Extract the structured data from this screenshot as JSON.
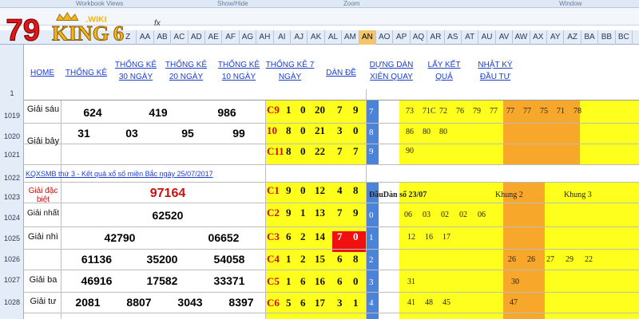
{
  "ribbon": {
    "labels": [
      "Workbook Views",
      "Show/Hide",
      "Zoom",
      "Window"
    ]
  },
  "formula_bar": {
    "name_box": "",
    "fx": "fx"
  },
  "logo": {
    "number": "79",
    "brand": "KING",
    "suffix": ".WIKI",
    "digit": "6"
  },
  "columns": [
    "Z",
    "AA",
    "AB",
    "AC",
    "AD",
    "AE",
    "AF",
    "AG",
    "AH",
    "AI",
    "AJ",
    "AK",
    "AL",
    "AM",
    "AN",
    "AO",
    "AP",
    "AQ",
    "AR",
    "AS",
    "AT",
    "AU",
    "AV",
    "AW",
    "AX",
    "AY",
    "AZ",
    "BA",
    "BB",
    "BC"
  ],
  "selected_column": "AN",
  "rows": [
    "1",
    "1019",
    "1020",
    "1021",
    "1022",
    "1023",
    "1024",
    "1025",
    "1026",
    "1027",
    "1028"
  ],
  "header_links": [
    "HOME",
    "THỐNG KÊ",
    "THỐNG KÊ 30 NGÀY",
    "THỐNG KÊ 20 NGÀY",
    "THỐNG KÊ 10 NGÀY",
    "THỐNG KÊ 7 NGÀY",
    "DÀN ĐỀ",
    "DỰNG DÀN XIÊN QUAY",
    "LẤY KẾT QUẢ",
    "NHẬT KÝ ĐẦU TƯ"
  ],
  "results": {
    "label_sau": "Giải sáu",
    "sau": [
      "624",
      "419",
      "986"
    ],
    "label_bay": "Giải bảy",
    "bay": [
      "31",
      "03",
      "95",
      "99"
    ],
    "title": "KQXSMB thứ 3 - Kết quả xổ số miền Bắc ngày 25/07/2017",
    "label_db": "Giải đặc biệt",
    "db": "97164",
    "label_nhat": "Giải nhất",
    "nhat": "62520",
    "label_nhi": "Giải nhì",
    "nhi": [
      "42790",
      "06652"
    ],
    "label_ba": "Giải ba",
    "ba1": [
      "61136",
      "35200",
      "54058"
    ],
    "ba2": [
      "46916",
      "17582",
      "33371"
    ],
    "label_tu": "Giải tư",
    "tu": [
      "2081",
      "8807",
      "3043",
      "8397"
    ]
  },
  "stats_rows": [
    {
      "code": "C9",
      "d": [
        "1",
        "0",
        "20",
        "7",
        "9"
      ]
    },
    {
      "code": "10",
      "d": [
        "8",
        "0",
        "21",
        "3",
        "0"
      ]
    },
    {
      "code": "C11",
      "d": [
        "8",
        "0",
        "22",
        "7",
        "7"
      ]
    },
    {
      "code": "C1",
      "d": [
        "9",
        "0",
        "12",
        "4",
        "8"
      ]
    },
    {
      "code": "C2",
      "d": [
        "9",
        "1",
        "13",
        "7",
        "9"
      ]
    },
    {
      "code": "C3",
      "d": [
        "6",
        "2",
        "14",
        "7",
        "0"
      ]
    },
    {
      "code": "C4",
      "d": [
        "1",
        "2",
        "15",
        "6",
        "8"
      ]
    },
    {
      "code": "C5",
      "d": [
        "1",
        "6",
        "16",
        "6",
        "0"
      ]
    },
    {
      "code": "C6",
      "d": [
        "5",
        "6",
        "17",
        "3",
        "1"
      ]
    }
  ],
  "index_col": [
    "7",
    "8",
    "9",
    "0",
    "1",
    "2",
    "3",
    "4"
  ],
  "right_rows": [
    [
      "73",
      "71C",
      "72",
      "76",
      "79",
      "77",
      "77",
      "77",
      "75",
      "71",
      "78"
    ],
    [
      "86",
      "80",
      "80"
    ],
    [
      "90"
    ],
    [
      "06",
      "03",
      "02",
      "02",
      "06"
    ],
    [
      "12",
      "16",
      "17"
    ],
    [
      "26",
      "26",
      "27",
      "29",
      "22"
    ],
    [
      "31",
      "30"
    ],
    [
      "41",
      "48",
      "45",
      "47"
    ]
  ],
  "dan_header": {
    "label": "ĐầuDàn số 23/07",
    "khung2": "Khung 2",
    "khung3": "Khung 3"
  },
  "colors": {
    "yellow": "#ffff1e",
    "orange": "#f7a72a",
    "blue": "#4a84d8",
    "red": "#f01010",
    "link": "#1a3ecf"
  }
}
